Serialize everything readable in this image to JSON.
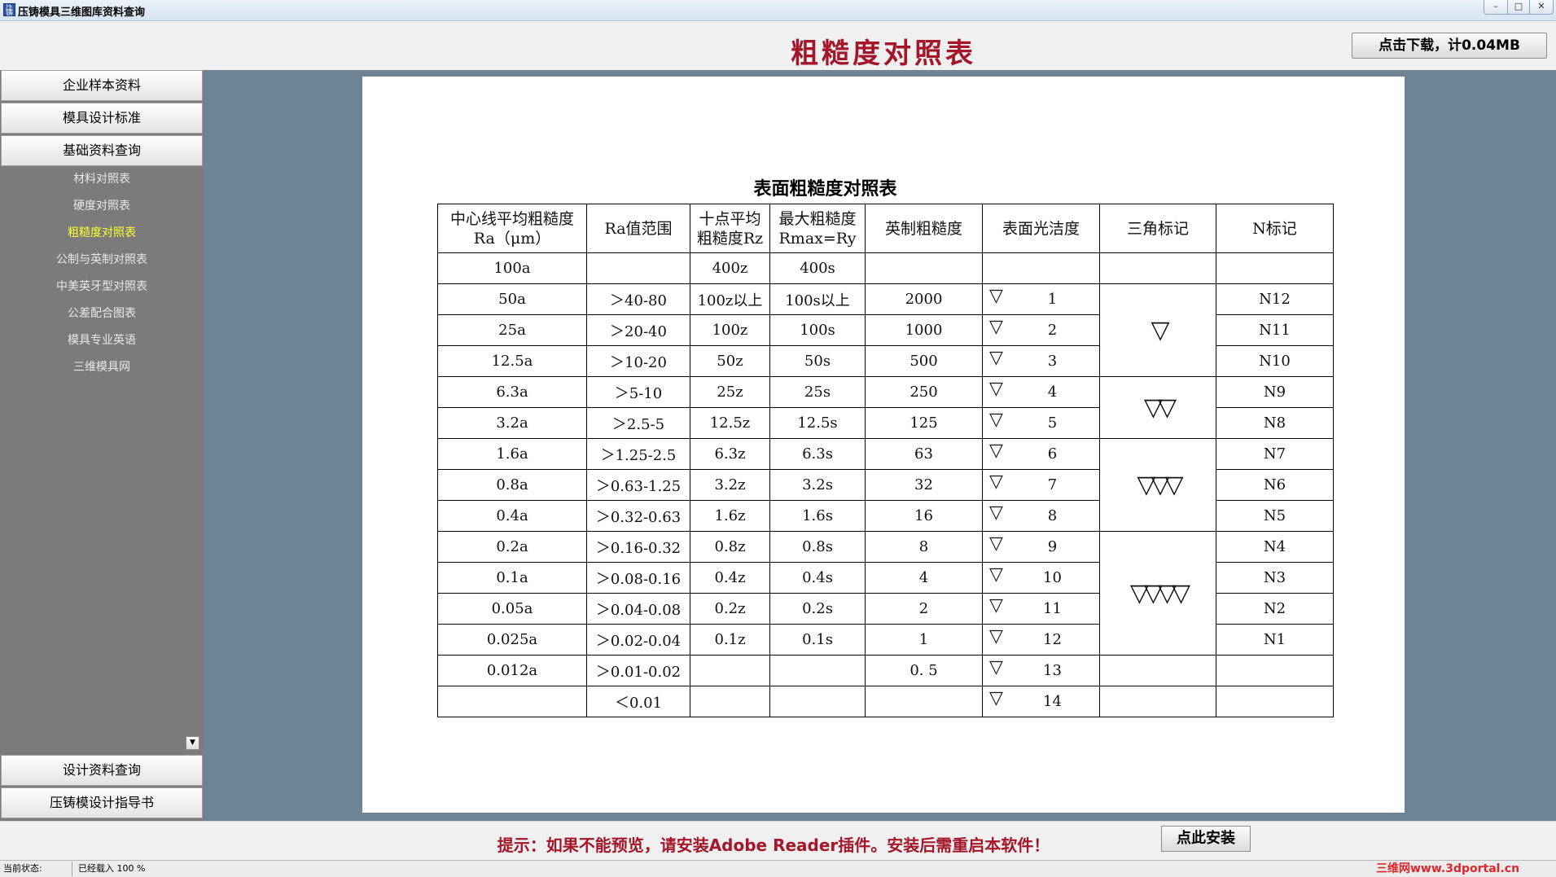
{
  "window": {
    "title": "压铸模具三维图库资料查询",
    "app_icon_text": "压铸"
  },
  "header": {
    "page_title": "粗糙度对照表",
    "download_label": "点击下载，计0.04MB"
  },
  "sidebar": {
    "top_items": [
      {
        "label": "企业样本资料"
      },
      {
        "label": "模具设计标准"
      },
      {
        "label": "基础资料查询"
      }
    ],
    "sub_items": [
      {
        "label": "材料对照表"
      },
      {
        "label": "硬度对照表"
      },
      {
        "label": "粗糙度对照表",
        "active": true
      },
      {
        "label": "公制与英制对照表"
      },
      {
        "label": "中美英牙型对照表"
      },
      {
        "label": "公差配合图表"
      },
      {
        "label": "模具专业英语"
      },
      {
        "label": "三维模具网"
      }
    ],
    "bottom_items": [
      {
        "label": "设计资料查询"
      },
      {
        "label": "压铸模设计指导书"
      }
    ],
    "scroll_glyph": "▼"
  },
  "table": {
    "title": "表面粗糙度对照表",
    "headers": [
      "中心线平均粗糙度 Ra（μm）",
      "Ra值范围",
      "十点平均 粗糙度Rz",
      "最大粗糙度 Rmax=Ry",
      "英制粗糙度",
      "表面光洁度",
      "三角标记",
      "N标记"
    ],
    "triangle_glyph": "▽",
    "rows": [
      {
        "ra": "100a",
        "range": "",
        "rz": "400z",
        "rmax": "400s",
        "imperial": "",
        "finish": "",
        "n": ""
      },
      {
        "ra": "50a",
        "range": "＞40-80",
        "rz": "100z以上",
        "rmax": "100s以上",
        "imperial": "2000",
        "finish": "1",
        "n": "N12"
      },
      {
        "ra": "25a",
        "range": "＞20-40",
        "rz": "100z",
        "rmax": "100s",
        "imperial": "1000",
        "finish": "2",
        "n": "N11"
      },
      {
        "ra": "12.5a",
        "range": "＞10-20",
        "rz": "50z",
        "rmax": "50s",
        "imperial": "500",
        "finish": "3",
        "n": "N10"
      },
      {
        "ra": "6.3a",
        "range": "＞5-10",
        "rz": "25z",
        "rmax": "25s",
        "imperial": "250",
        "finish": "4",
        "n": "N9"
      },
      {
        "ra": "3.2a",
        "range": "＞2.5-5",
        "rz": "12.5z",
        "rmax": "12.5s",
        "imperial": "125",
        "finish": "5",
        "n": "N8"
      },
      {
        "ra": "1.6a",
        "range": "＞1.25-2.5",
        "rz": "6.3z",
        "rmax": "6.3s",
        "imperial": "63",
        "finish": "6",
        "n": "N7"
      },
      {
        "ra": "0.8a",
        "range": "＞0.63-1.25",
        "rz": "3.2z",
        "rmax": "3.2s",
        "imperial": "32",
        "finish": "7",
        "n": "N6"
      },
      {
        "ra": "0.4a",
        "range": "＞0.32-0.63",
        "rz": "1.6z",
        "rmax": "1.6s",
        "imperial": "16",
        "finish": "8",
        "n": "N5"
      },
      {
        "ra": "0.2a",
        "range": "＞0.16-0.32",
        "rz": "0.8z",
        "rmax": "0.8s",
        "imperial": "8",
        "finish": "9",
        "n": "N4"
      },
      {
        "ra": "0.1a",
        "range": "＞0.08-0.16",
        "rz": "0.4z",
        "rmax": "0.4s",
        "imperial": "4",
        "finish": "10",
        "n": "N3"
      },
      {
        "ra": "0.05a",
        "range": "＞0.04-0.08",
        "rz": "0.2z",
        "rmax": "0.2s",
        "imperial": "2",
        "finish": "11",
        "n": "N2"
      },
      {
        "ra": "0.025a",
        "range": "＞0.02-0.04",
        "rz": "0.1z",
        "rmax": "0.1s",
        "imperial": "1",
        "finish": "12",
        "n": "N1"
      },
      {
        "ra": "0.012a",
        "range": "＞0.01-0.02",
        "rz": "",
        "rmax": "",
        "imperial": "0. 5",
        "finish": "13",
        "n": ""
      },
      {
        "ra": "",
        "range": "＜0.01",
        "rz": "",
        "rmax": "",
        "imperial": "",
        "finish": "14",
        "n": ""
      }
    ],
    "triangle_marks": [
      {
        "label": "",
        "rows": 1
      },
      {
        "label": "▽",
        "rows": 3
      },
      {
        "label": "▽▽",
        "rows": 2
      },
      {
        "label": "▽▽▽",
        "rows": 3
      },
      {
        "label": "▽▽▽▽",
        "rows": 4
      },
      {
        "label": "",
        "rows": 1
      },
      {
        "label": "",
        "rows": 1
      }
    ]
  },
  "footer": {
    "hint": "提示：如果不能预览，请安装Adobe Reader插件。安装后需重启本软件！",
    "install_label": "点此安装"
  },
  "status": {
    "label": "当前状态:",
    "value": "已经载入 100 %",
    "watermark": "三维网www.3dportal.cn"
  }
}
